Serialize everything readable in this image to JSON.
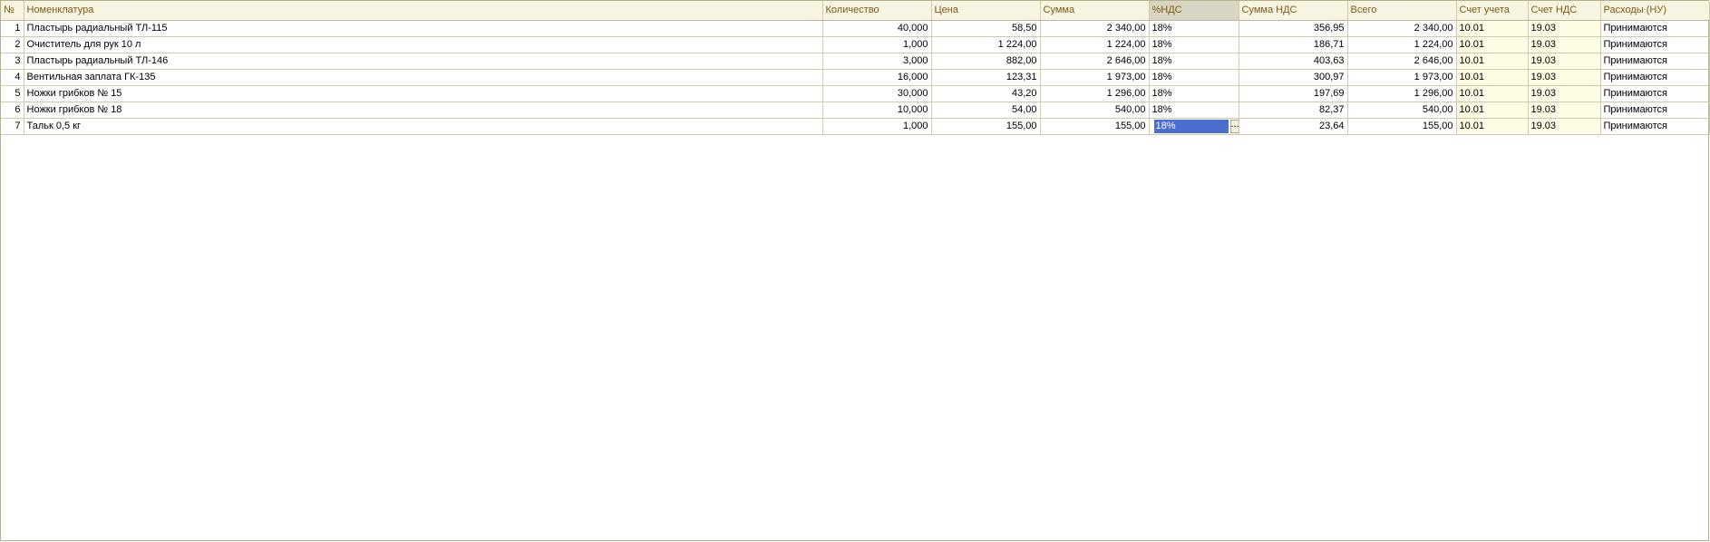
{
  "table": {
    "columns": [
      {
        "key": "n",
        "label": "№"
      },
      {
        "key": "item",
        "label": "Номенклатура"
      },
      {
        "key": "qty",
        "label": "Количество"
      },
      {
        "key": "price",
        "label": "Цена"
      },
      {
        "key": "sum",
        "label": "Сумма"
      },
      {
        "key": "vat_rate",
        "label": "%НДС"
      },
      {
        "key": "vat_sum",
        "label": "Сумма НДС"
      },
      {
        "key": "total",
        "label": "Всего"
      },
      {
        "key": "account",
        "label": "Счет учета"
      },
      {
        "key": "vat_account",
        "label": "Счет НДС"
      },
      {
        "key": "expenses",
        "label": "Расходы (НУ)"
      }
    ],
    "sorted_column": "vat_rate",
    "rows": [
      {
        "n": "1",
        "item": "Пластырь радиальный ТЛ-115",
        "qty": "40,000",
        "price": "58,50",
        "sum": "2 340,00",
        "vat_rate": "18%",
        "vat_sum": "356,95",
        "total": "2 340,00",
        "account": "10.01",
        "vat_account": "19.03",
        "expenses": "Принимаются"
      },
      {
        "n": "2",
        "item": "Очиститель для рук 10 л",
        "qty": "1,000",
        "price": "1 224,00",
        "sum": "1 224,00",
        "vat_rate": "18%",
        "vat_sum": "186,71",
        "total": "1 224,00",
        "account": "10.01",
        "vat_account": "19.03",
        "expenses": "Принимаются"
      },
      {
        "n": "3",
        "item": "Пластырь радиальный ТЛ-146",
        "qty": "3,000",
        "price": "882,00",
        "sum": "2 646,00",
        "vat_rate": "18%",
        "vat_sum": "403,63",
        "total": "2 646,00",
        "account": "10.01",
        "vat_account": "19.03",
        "expenses": "Принимаются"
      },
      {
        "n": "4",
        "item": "Вентильная заплата ГК-135",
        "qty": "16,000",
        "price": "123,31",
        "sum": "1 973,00",
        "vat_rate": "18%",
        "vat_sum": "300,97",
        "total": "1 973,00",
        "account": "10.01",
        "vat_account": "19.03",
        "expenses": "Принимаются"
      },
      {
        "n": "5",
        "item": "Ножки грибков № 15",
        "qty": "30,000",
        "price": "43,20",
        "sum": "1 296,00",
        "vat_rate": "18%",
        "vat_sum": "197,69",
        "total": "1 296,00",
        "account": "10.01",
        "vat_account": "19.03",
        "expenses": "Принимаются"
      },
      {
        "n": "6",
        "item": "Ножки грибков № 18",
        "qty": "10,000",
        "price": "54,00",
        "sum": "540,00",
        "vat_rate": "18%",
        "vat_sum": "82,37",
        "total": "540,00",
        "account": "10.01",
        "vat_account": "19.03",
        "expenses": "Принимаются"
      },
      {
        "n": "7",
        "item": "Тальк 0,5 кг",
        "qty": "1,000",
        "price": "155,00",
        "sum": "155,00",
        "vat_rate": "18%",
        "vat_sum": "23,64",
        "total": "155,00",
        "account": "10.01",
        "vat_account": "19.03",
        "expenses": "Принимаются"
      }
    ],
    "editing": {
      "row": 6,
      "column": "vat_rate",
      "select_button_label": "..."
    }
  },
  "colors": {
    "header_bg": "#f7f4e2",
    "header_text": "#7a5b1a",
    "selection": "#4a6fd0",
    "account_bg": "#fdfbe3"
  }
}
